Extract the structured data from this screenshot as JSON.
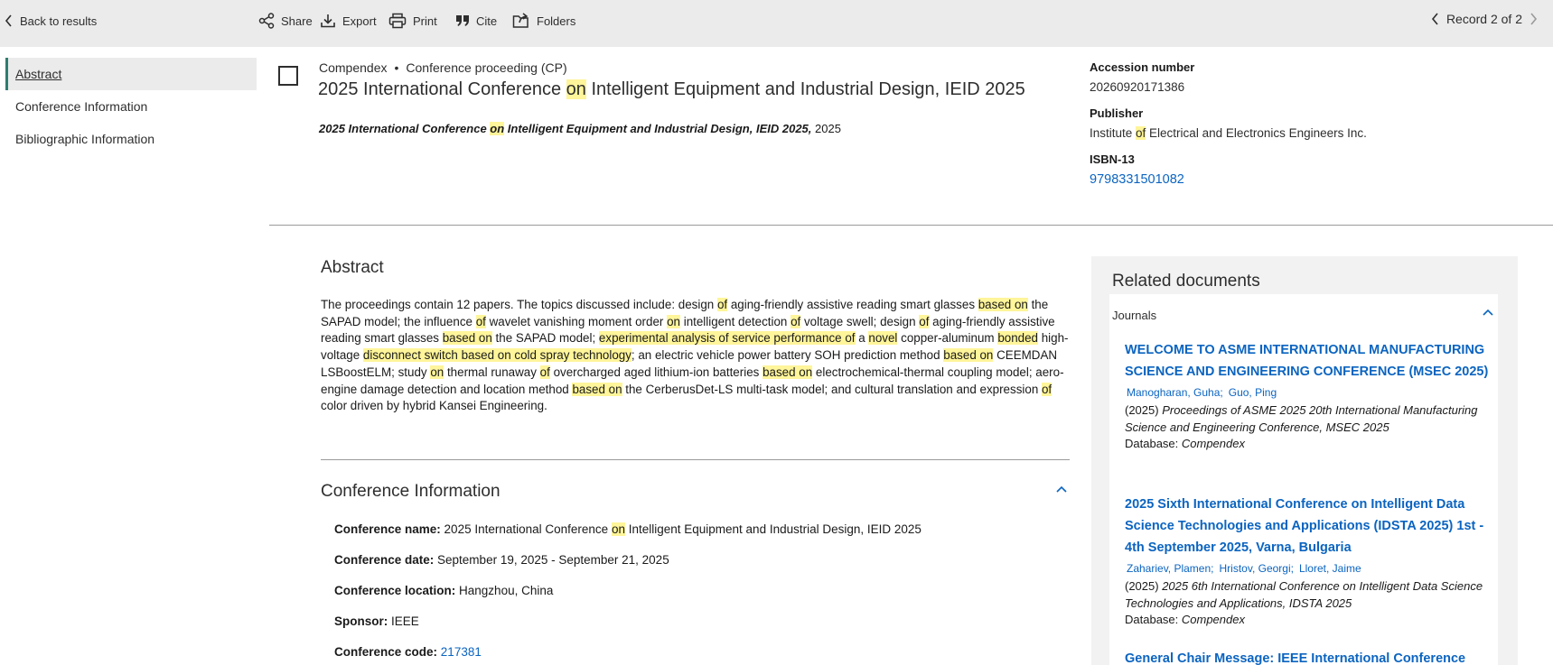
{
  "toolbar": {
    "back_label": "Back to results",
    "share_label": "Share",
    "export_label": "Export",
    "print_label": "Print",
    "cite_label": "Cite",
    "folders_label": "Folders",
    "record_label": "Record 2 of 2"
  },
  "sidebar": {
    "items": [
      {
        "label": "Abstract",
        "active": true
      },
      {
        "label": "Conference Information"
      },
      {
        "label": "Bibliographic Information"
      }
    ]
  },
  "record": {
    "database": "Compendex",
    "doc_type": "Conference proceeding (CP)",
    "title_pre": "2025 International Conference ",
    "title_hl": "on",
    "title_post": " Intelligent Equipment and Industrial Design, IEID 2025",
    "source_pre": "2025 International Conference ",
    "source_hl": "on",
    "source_post": " Intelligent Equipment and Industrial Design, IEID 2025,",
    "source_year": " 2025"
  },
  "meta": {
    "accession_label": "Accession number",
    "accession_value": "20260920171386",
    "publisher_label": "Publisher",
    "publisher_pre": "Institute ",
    "publisher_hl": "of",
    "publisher_post": " Electrical and Electronics Engineers Inc.",
    "isbn_label": "ISBN-13",
    "isbn_value": "9798331501082"
  },
  "abstract": {
    "heading": "Abstract",
    "segments": [
      {
        "t": "The proceedings contain 12 papers. The topics discussed include: design "
      },
      {
        "t": "of",
        "h": true
      },
      {
        "t": " aging-friendly assistive reading smart glasses "
      },
      {
        "t": "based on",
        "h": true
      },
      {
        "t": " the SAPAD model; the influence "
      },
      {
        "t": "of",
        "h": true
      },
      {
        "t": " wavelet vanishing moment order "
      },
      {
        "t": "on",
        "h": true
      },
      {
        "t": " intelligent detection "
      },
      {
        "t": "of",
        "h": true
      },
      {
        "t": " voltage swell; design "
      },
      {
        "t": "of",
        "h": true
      },
      {
        "t": " aging-friendly assistive reading smart glasses "
      },
      {
        "t": "based on",
        "h": true
      },
      {
        "t": " the SAPAD model; "
      },
      {
        "t": "experimental analysis of service performance of",
        "h": true
      },
      {
        "t": " a "
      },
      {
        "t": "novel",
        "h": true
      },
      {
        "t": " copper-aluminum "
      },
      {
        "t": "bonded",
        "h": true
      },
      {
        "t": " high-voltage "
      },
      {
        "t": "disconnect switch based on cold spray technology",
        "h": true
      },
      {
        "t": "; an electric vehicle power battery SOH prediction method "
      },
      {
        "t": "based on",
        "h": true
      },
      {
        "t": " CEEMDAN LSBoostELM; study "
      },
      {
        "t": "on",
        "h": true
      },
      {
        "t": " thermal runaway "
      },
      {
        "t": "of",
        "h": true
      },
      {
        "t": " overcharged aged lithium-ion batteries "
      },
      {
        "t": "based on",
        "h": true
      },
      {
        "t": " electrochemical-thermal coupling model; aero-engine damage detection and location method "
      },
      {
        "t": "based on",
        "h": true
      },
      {
        "t": " the CerberusDet-LS multi-task model; and cultural translation and expression "
      },
      {
        "t": "of",
        "h": true
      },
      {
        "t": " color driven by hybrid Kansei Engineering."
      }
    ]
  },
  "conference": {
    "heading": "Conference Information",
    "name_label": "Conference name:",
    "name_pre": " 2025 International Conference ",
    "name_hl": "on",
    "name_post": " Intelligent Equipment and Industrial Design, IEID 2025",
    "date_label": "Conference date:",
    "date_value": " September 19, 2025 - September 21, 2025",
    "location_label": "Conference location:",
    "location_value": " Hangzhou, China",
    "sponsor_label": "Sponsor:",
    "sponsor_value": " IEEE",
    "code_label": "Conference code:",
    "code_value": "217381"
  },
  "related": {
    "heading": "Related documents",
    "group_label": "Journals",
    "docs": [
      {
        "title": "WELCOME TO ASME INTERNATIONAL MANUFACTURING SCIENCE AND ENGINEERING CONFERENCE (MSEC 2025)",
        "authors": [
          "Manogharan, Guha;",
          "Guo, Ping"
        ],
        "year": "(2025) ",
        "source": "Proceedings of ASME 2025 20th International Manufacturing Science and Engineering Conference, MSEC 2025",
        "db_label": "Database: ",
        "db": "Compendex"
      },
      {
        "title": "2025 Sixth International Conference on Intelligent Data Science Technologies and Applications (IDSTA 2025) 1st - 4th September 2025, Varna, Bulgaria",
        "authors": [
          "Zahariev, Plamen;",
          "Hristov, Georgi;",
          "Lloret, Jaime"
        ],
        "year": "(2025) ",
        "source": "2025 6th International Conference on Intelligent Data Science Technologies and Applications, IDSTA 2025",
        "db_label": "Database: ",
        "db": "Compendex"
      },
      {
        "title": "General Chair Message: IEEE International Conference"
      }
    ]
  },
  "colors": {
    "highlight": "#fff59a",
    "link": "#0b64c0",
    "toolbar_bg": "#ebebeb",
    "active_accent": "#2e7d6f"
  }
}
